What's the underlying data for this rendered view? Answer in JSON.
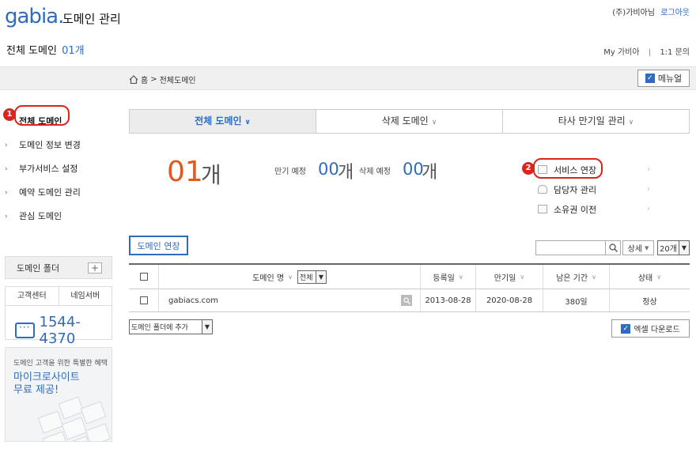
{
  "header": {
    "logo": "gabia.",
    "app_title": "도메인 관리",
    "user_name": "(주)가비아님",
    "logout": "로그아웃",
    "page_title": "전체 도메인",
    "page_count": "01개",
    "my_gabia": "My 가비아",
    "separator": "|",
    "inquiry": "1:1 문의"
  },
  "breadcrumb": {
    "home": "홈",
    "separator": ">",
    "current": "전체도메인",
    "manual_button": "메뉴얼"
  },
  "annotations": {
    "marker1": "1",
    "marker2": "2",
    "accent_color": "#d9261c"
  },
  "sidebar": {
    "items": [
      {
        "label": "전체 도메인"
      },
      {
        "label": "도메인 정보 변경"
      },
      {
        "label": "부가서비스 설정"
      },
      {
        "label": "예약 도메인 관리"
      },
      {
        "label": "관심 도메인"
      }
    ],
    "folder_label": "도메인 폴더",
    "folder_add": "+",
    "cs_tabs": [
      "고객센터",
      "네임서버"
    ],
    "phone": "1544-4370",
    "promo_sub": "도메인 고객을 위한 특별한 혜택",
    "promo_title_1": "마이크로사이트",
    "promo_title_2": "무료 제공!"
  },
  "tabs": [
    {
      "label": "전체 도메인",
      "active": true
    },
    {
      "label": "삭제 도메인",
      "active": false
    },
    {
      "label": "타사 만기일 관리",
      "active": false
    }
  ],
  "summary": {
    "total_count": "01",
    "total_unit": "개",
    "expire_label": "만기 예정",
    "expire_count": "00",
    "expire_unit": "개",
    "delete_label": "삭제 예정",
    "delete_count": "00",
    "delete_unit": "개"
  },
  "quick_links": [
    {
      "label": "서비스 연장",
      "icon": "card-icon"
    },
    {
      "label": "담당자 관리",
      "icon": "person-icon"
    },
    {
      "label": "소유권 이전",
      "icon": "document-icon"
    }
  ],
  "actions": {
    "renew_button": "도메인 연장",
    "search_placeholder": "",
    "detail_select": "상세",
    "count_select": "20개"
  },
  "table": {
    "headers": {
      "domain": "도메인 명",
      "domain_filter": "전체",
      "registered": "등록일",
      "expires": "만기일",
      "remaining": "남은 기간",
      "status": "상태"
    },
    "rows": [
      {
        "domain": "gabiacs.com",
        "registered": "2013-08-28",
        "expires": "2020-08-28",
        "remaining": "380일",
        "status": "정상"
      }
    ]
  },
  "footer": {
    "folder_select": "도메인 폴더에 추가",
    "excel_button": "엑셀 다운로드"
  },
  "colors": {
    "brand": "#2f6bbf",
    "count_orange": "#e05a1e"
  }
}
